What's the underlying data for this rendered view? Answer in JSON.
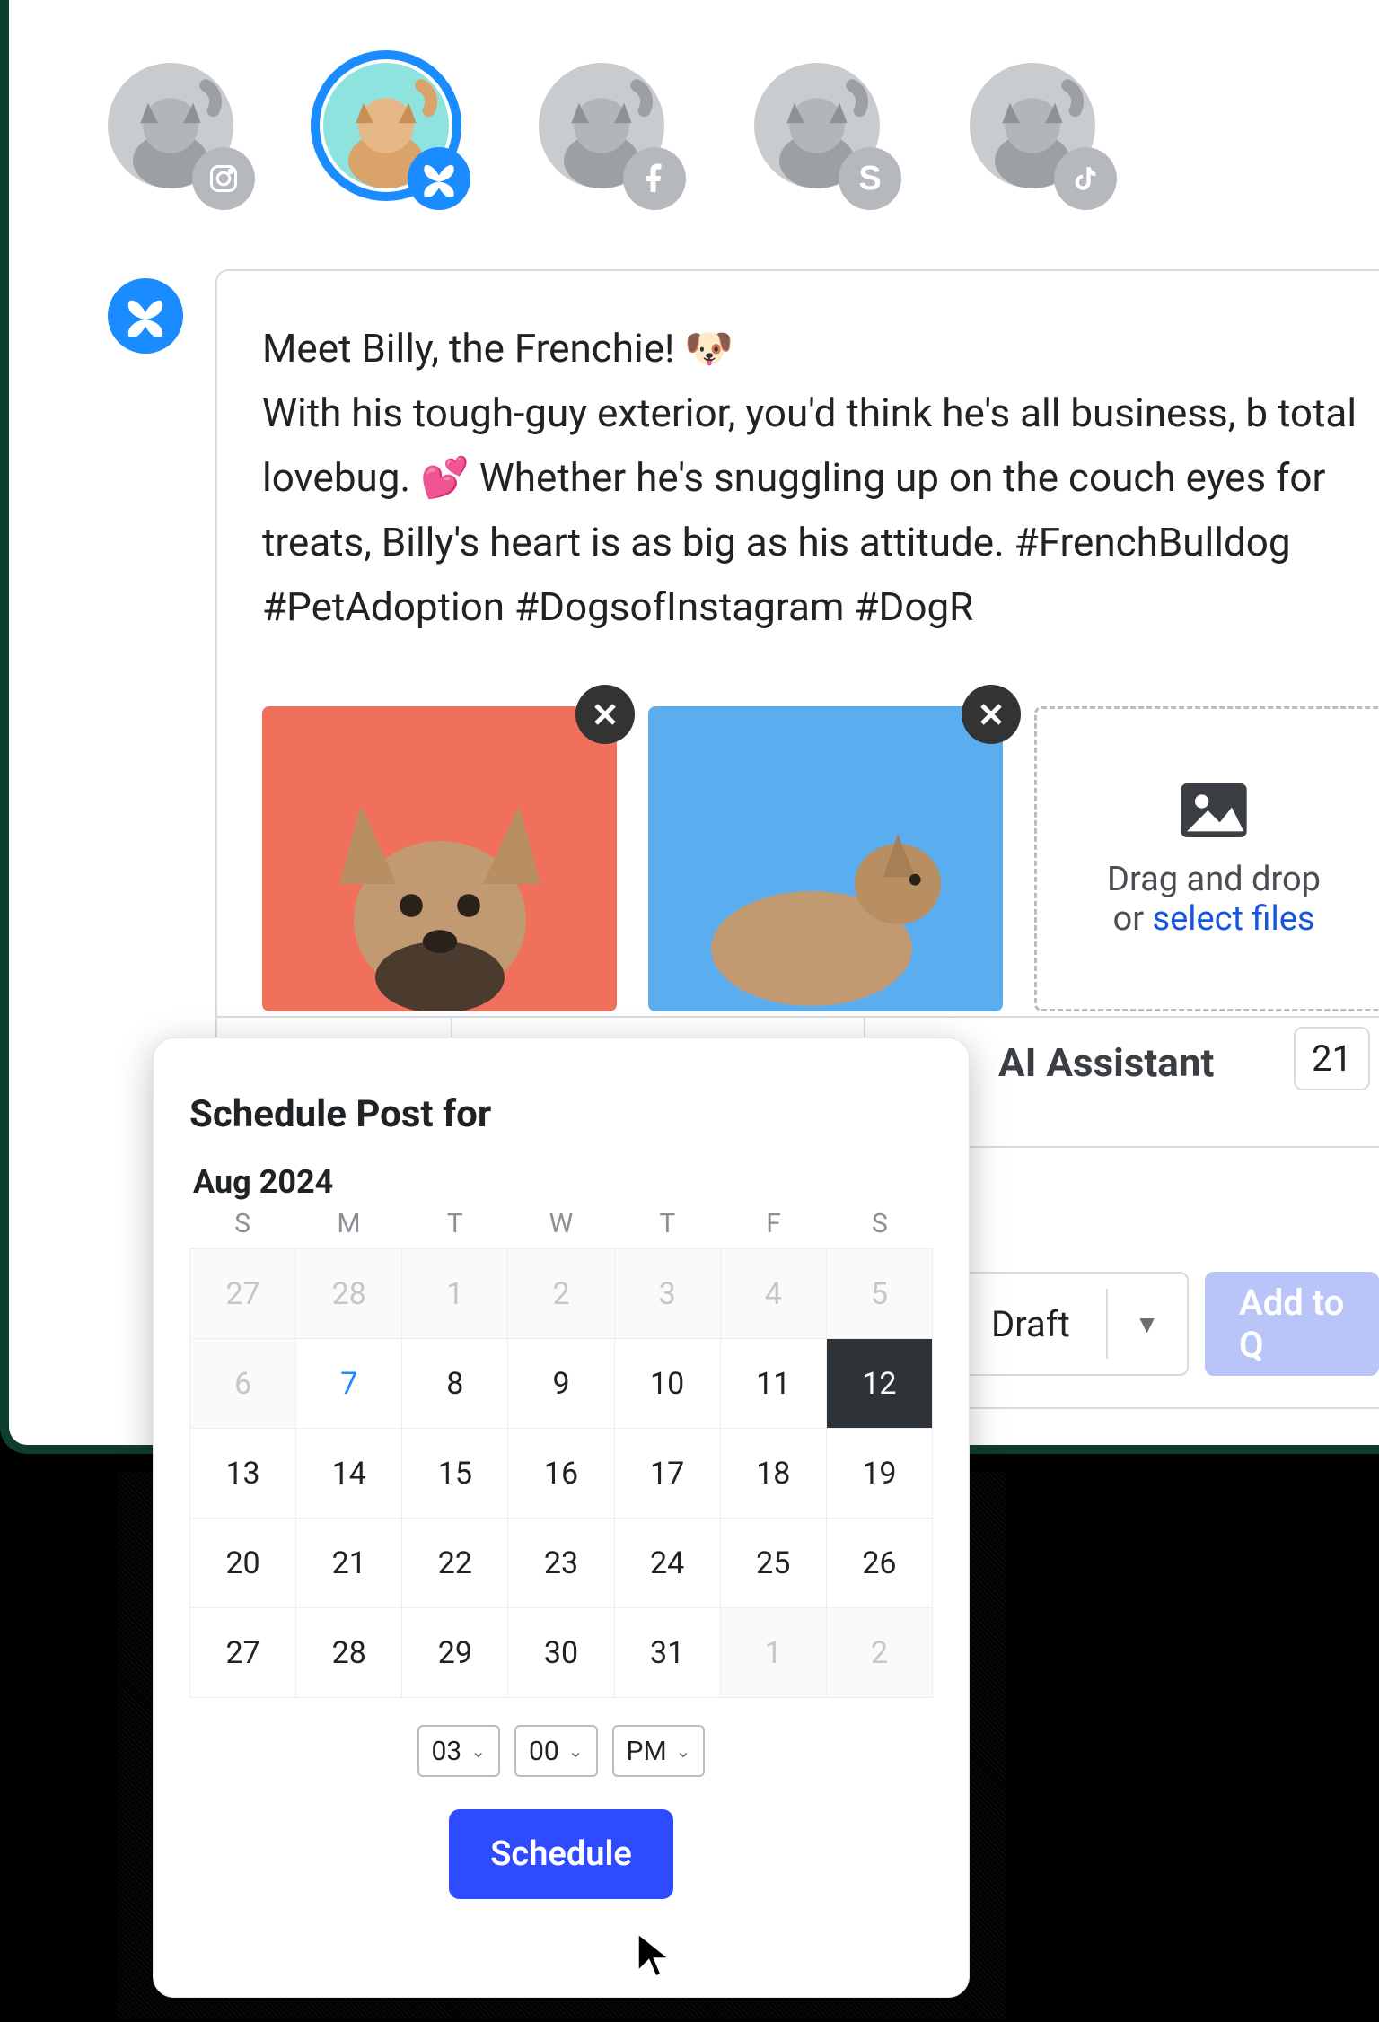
{
  "accounts": [
    {
      "platform": "instagram"
    },
    {
      "platform": "bluesky",
      "active": true
    },
    {
      "platform": "facebook"
    },
    {
      "platform": "s-network"
    },
    {
      "platform": "tiktok"
    }
  ],
  "post": {
    "text": "Meet Billy, the Frenchie! 🐶\nWith his tough-guy exterior, you'd think he's all business, b total lovebug. 💕 Whether he's snuggling up on the couch eyes for treats, Billy's heart is as big as his attitude. #FrenchBulldog #PetAdoption #DogsofInstagram #DogR"
  },
  "attachments": {
    "dropzone_line1": "Drag and drop",
    "dropzone_or": "or ",
    "dropzone_link": "select files"
  },
  "toolbar": {
    "ai_label": "AI Assistant",
    "counter": "21",
    "draft_label": "Draft",
    "queue_label": "Add to Q"
  },
  "schedule": {
    "title": "Schedule Post for",
    "month": "Aug 2024",
    "dow": [
      "S",
      "M",
      "T",
      "W",
      "T",
      "F",
      "S"
    ],
    "weeks": [
      [
        {
          "n": "27",
          "dim": true
        },
        {
          "n": "28",
          "dim": true
        },
        {
          "n": "1",
          "dim": true
        },
        {
          "n": "2",
          "dim": true
        },
        {
          "n": "3",
          "dim": true
        },
        {
          "n": "4",
          "dim": true
        },
        {
          "n": "5",
          "dim": true
        }
      ],
      [
        {
          "n": "6",
          "dim": true
        },
        {
          "n": "7",
          "today": true
        },
        {
          "n": "8"
        },
        {
          "n": "9"
        },
        {
          "n": "10"
        },
        {
          "n": "11"
        },
        {
          "n": "12",
          "selected": true
        }
      ],
      [
        {
          "n": "13"
        },
        {
          "n": "14"
        },
        {
          "n": "15"
        },
        {
          "n": "16"
        },
        {
          "n": "17"
        },
        {
          "n": "18"
        },
        {
          "n": "19"
        }
      ],
      [
        {
          "n": "20"
        },
        {
          "n": "21"
        },
        {
          "n": "22"
        },
        {
          "n": "23"
        },
        {
          "n": "24"
        },
        {
          "n": "25"
        },
        {
          "n": "26"
        }
      ],
      [
        {
          "n": "27"
        },
        {
          "n": "28"
        },
        {
          "n": "29"
        },
        {
          "n": "30"
        },
        {
          "n": "31"
        },
        {
          "n": "1",
          "dim": true
        },
        {
          "n": "2",
          "dim": true
        }
      ]
    ],
    "hour": "03",
    "minute": "00",
    "ampm": "PM",
    "button": "Schedule"
  }
}
